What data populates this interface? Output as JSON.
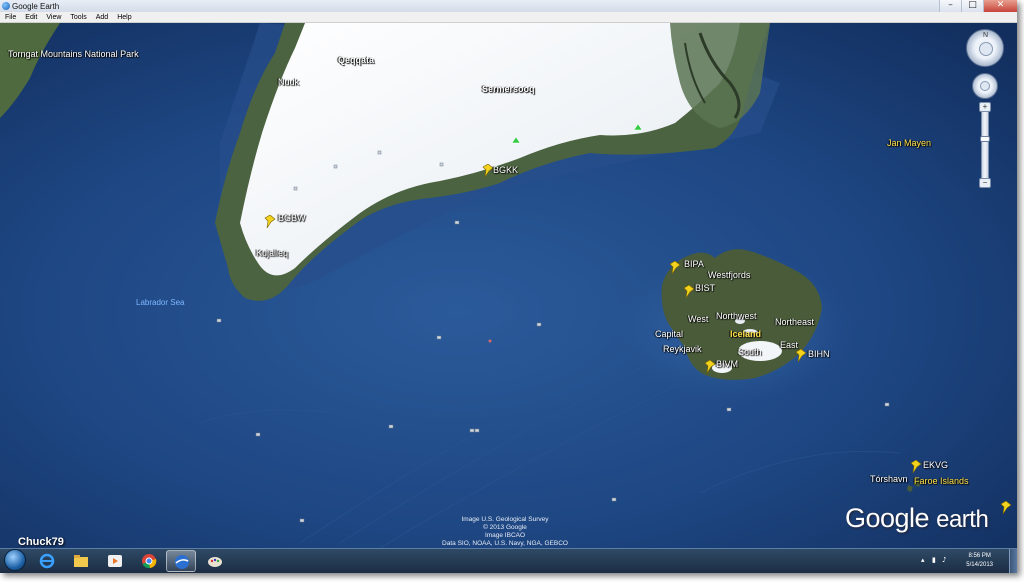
{
  "window": {
    "title": "Google Earth",
    "controls": {
      "minimize": "–",
      "maximize": "□",
      "close": "✕"
    }
  },
  "menu": [
    "File",
    "Edit",
    "View",
    "Tools",
    "Add",
    "Help"
  ],
  "map": {
    "places": [
      {
        "text": "Torngat Mountains National Park",
        "style": "white"
      },
      {
        "text": "Qeqqata",
        "style": "white-bold"
      },
      {
        "text": "Nuuk",
        "style": "white"
      },
      {
        "text": "Sermersooq",
        "style": "white-bold"
      },
      {
        "text": "BGKK",
        "style": "white"
      },
      {
        "text": "BGBW",
        "style": "white"
      },
      {
        "text": "Kujalleq",
        "style": "white"
      },
      {
        "text": "Jan Mayen",
        "style": "yellow"
      },
      {
        "text": "Labrador Sea",
        "style": "blue"
      },
      {
        "text": "BIPA",
        "style": "white"
      },
      {
        "text": "Westfjords",
        "style": "white"
      },
      {
        "text": "BIST",
        "style": "white"
      },
      {
        "text": "Northwest",
        "style": "white"
      },
      {
        "text": "West",
        "style": "white"
      },
      {
        "text": "Iceland",
        "style": "yellow"
      },
      {
        "text": "Northeast",
        "style": "white"
      },
      {
        "text": "Capital",
        "style": "white"
      },
      {
        "text": "Reykjavik",
        "style": "white"
      },
      {
        "text": "East",
        "style": "white"
      },
      {
        "text": "South",
        "style": "white"
      },
      {
        "text": "BIHN",
        "style": "white"
      },
      {
        "text": "BIVM",
        "style": "white"
      },
      {
        "text": "EKVG",
        "style": "white"
      },
      {
        "text": "Tórshavn",
        "style": "white"
      },
      {
        "text": "Faroe Islands",
        "style": "yellow"
      }
    ],
    "attribution": [
      "Image U.S. Geological Survey",
      "© 2013 Google",
      "Image IBCAO",
      "Data SIO, NOAA, U.S. Navy, NGA, GEBCO"
    ],
    "logo": {
      "word1": "Google",
      "word2": "earth"
    },
    "watermark": "Chuck79",
    "nav": {
      "north": "N",
      "zoom_in": "+",
      "zoom_out": "−"
    }
  },
  "taskbar": {
    "apps": [
      "start-orb",
      "internet-explorer-icon",
      "file-explorer-icon",
      "media-player-icon",
      "chrome-icon",
      "google-earth-icon",
      "paint-icon"
    ],
    "active_app": "google-earth-icon",
    "clock": {
      "time": "8:56 PM",
      "date": "5/14/2013"
    },
    "tray_glyphs": [
      "▴",
      "▮",
      "♪"
    ]
  },
  "colors": {
    "ocean": "#1a3f7a",
    "ice": "#f4f7fa",
    "land": "#3f5a35",
    "pin": "#f2d21c"
  }
}
